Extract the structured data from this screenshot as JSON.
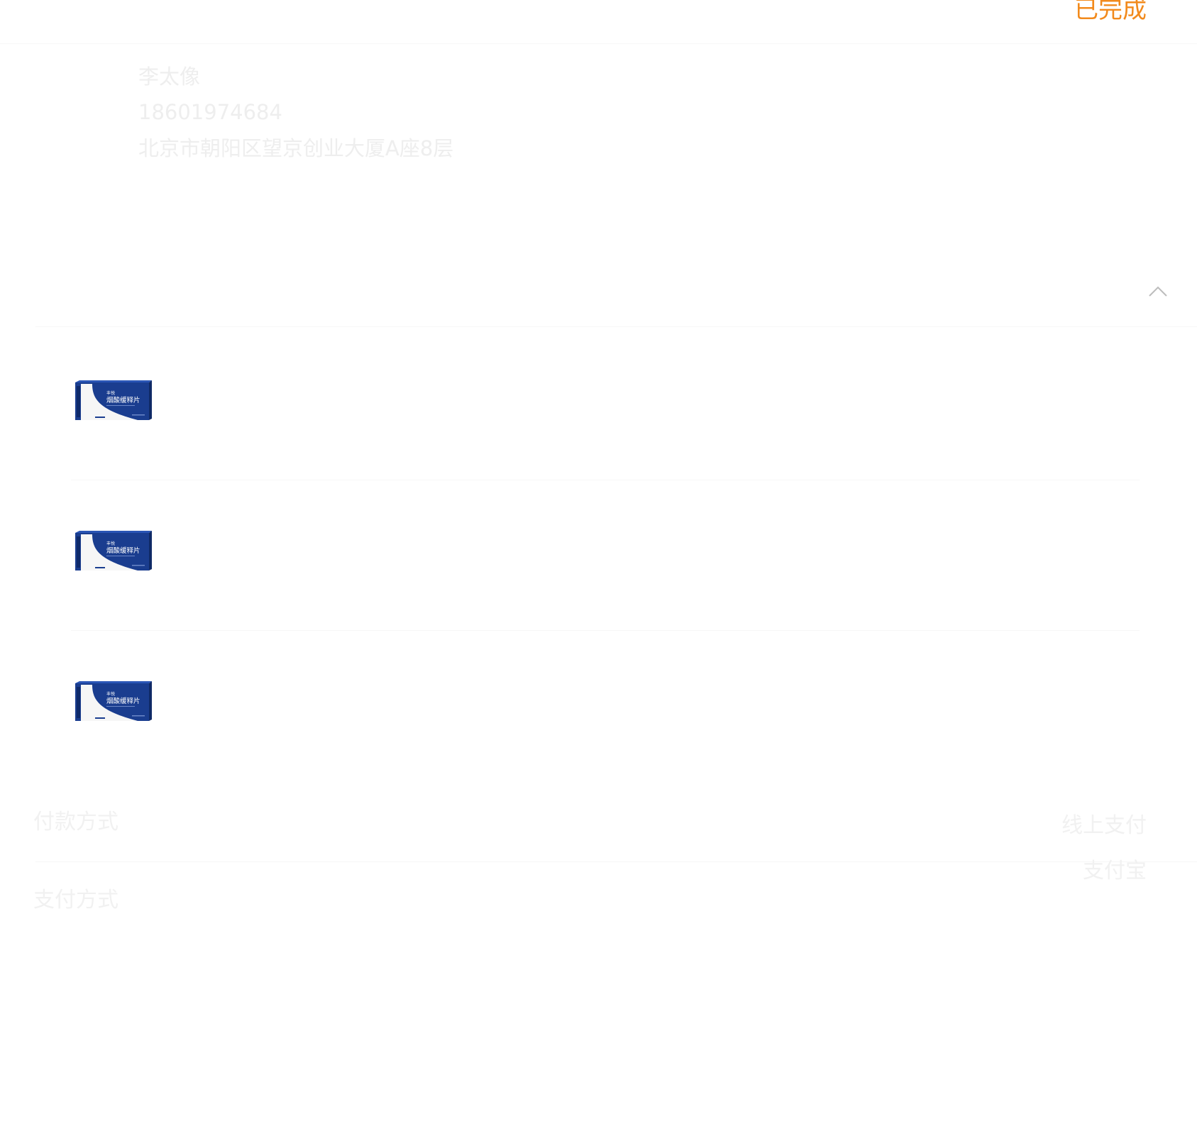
{
  "order": {
    "status": "已完成"
  },
  "recipient": {
    "name": "李太像",
    "phone": "18601974684",
    "address": "北京市朝阳区望京创业大厦A座8层"
  },
  "products": [
    {
      "image_icon": "medicine-box-image",
      "brand": "丰悦",
      "name": "烟酸缓释片"
    },
    {
      "image_icon": "medicine-box-image",
      "brand": "丰悦",
      "name": "烟酸缓释片"
    },
    {
      "image_icon": "medicine-box-image",
      "brand": "丰悦",
      "name": "烟酸缓释片"
    }
  ],
  "payment": {
    "method_label": "付款方式",
    "method_value": "线上支付",
    "type_label": "支付方式",
    "type_value": "支付宝"
  },
  "colors": {
    "status": "#f28a1c",
    "box_blue": "#1a3d8f"
  }
}
